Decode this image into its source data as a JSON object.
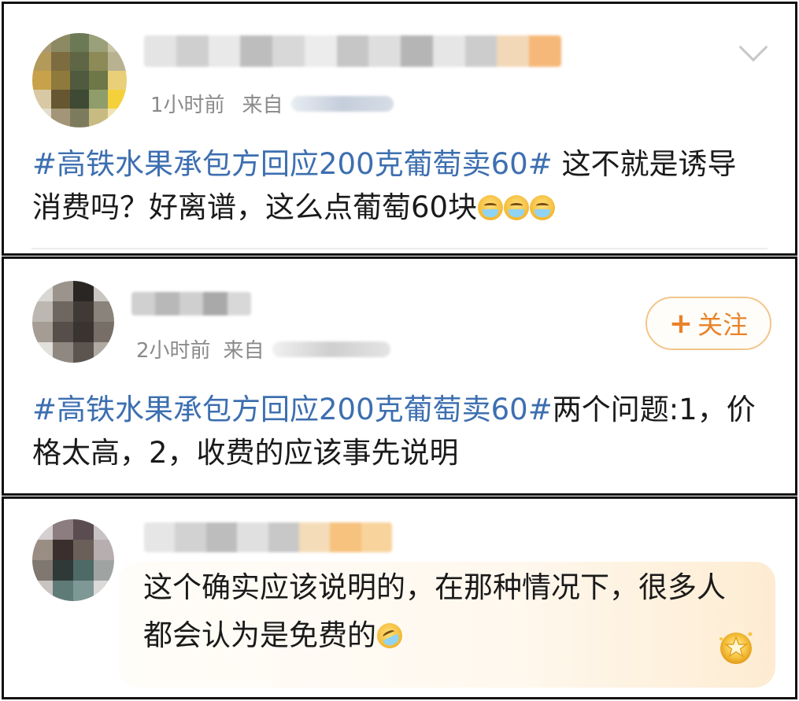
{
  "comments": [
    {
      "time": "1小时前",
      "source_label": "来自",
      "topic": "#高铁水果承包方回应200克葡萄卖60#",
      "text": " 这不就是诱导消费吗？好离谱，这么点葡萄60块",
      "emojis": [
        "crying-laughing-emoji",
        "crying-laughing-emoji",
        "crying-laughing-emoji"
      ],
      "has_more_menu": true
    },
    {
      "time": "2小时前",
      "source_label": "来自",
      "topic": "#高铁水果承包方回应200克葡萄卖60#",
      "text": "两个问题:1，价格太高，2，收费的应该事先说明",
      "follow_label": "关注"
    },
    {
      "text": "这个确实应该说明的，在那种情况下，很多人都会认为是免费的",
      "emojis": [
        "rolling-laughing-emoji"
      ],
      "badge": "gold-star-badge-icon"
    }
  ],
  "colors": {
    "topic_link": "#3d6fb0",
    "follow_accent": "#e8832a",
    "meta_gray": "#8a8a8a",
    "bubble_tint": "#fdecd2"
  }
}
